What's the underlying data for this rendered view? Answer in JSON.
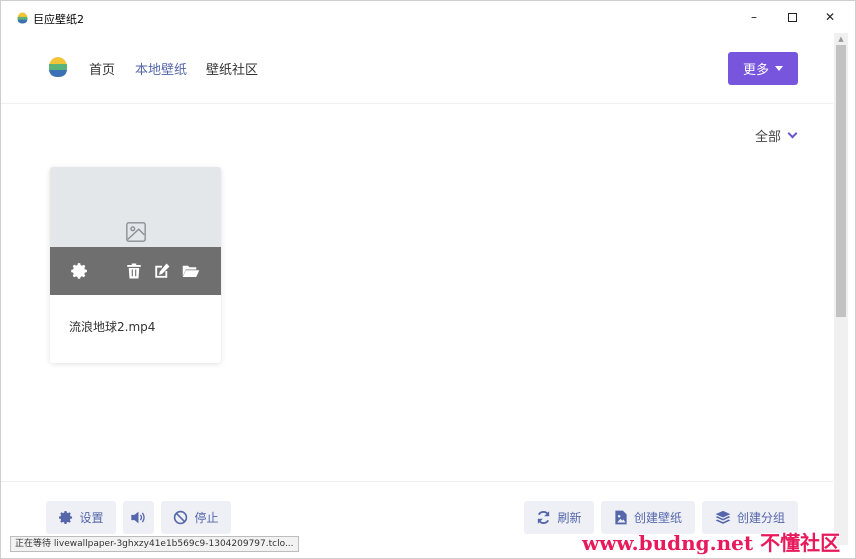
{
  "window": {
    "title": "巨应壁纸2"
  },
  "nav": {
    "home": "首页",
    "local": "本地壁纸",
    "community": "壁纸社区",
    "more": "更多"
  },
  "filter": {
    "label": "全部"
  },
  "card": {
    "name": "流浪地球2.mp4"
  },
  "toolbar": {
    "settings": "设置",
    "stop": "停止",
    "refresh": "刷新",
    "create_wallpaper": "创建壁纸",
    "create_group": "创建分组"
  },
  "status": {
    "text": "正在等待 livewallpaper-3ghxzy41e1b569c9-1304209797.tclo..."
  },
  "watermark": {
    "text": "www.budng.net 不懂社区"
  },
  "colors": {
    "accent": "#7755dd",
    "link": "#5566aa",
    "watermark": "#e8195c"
  }
}
